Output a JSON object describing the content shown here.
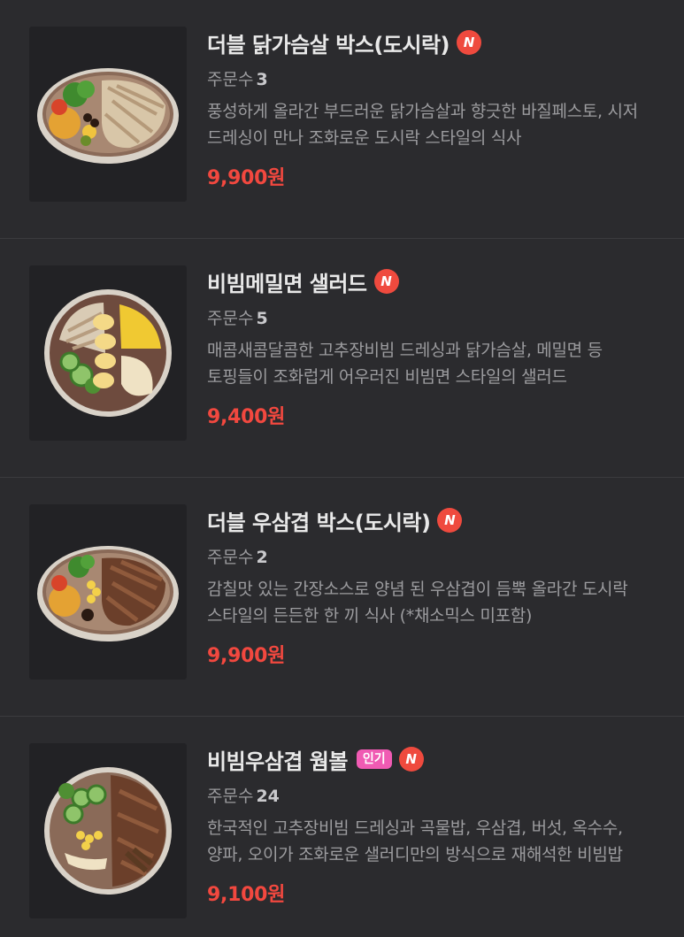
{
  "colors": {
    "background": "#2b2b2e",
    "price": "#f2483f",
    "new_badge": "#ef4a3e",
    "popular_badge": "#f05bb3",
    "divider": "#3b3b3e"
  },
  "labels": {
    "orders_prefix": "주문수",
    "new_badge": "N",
    "popular_badge": "인기"
  },
  "menu": [
    {
      "title": "더블 닭가슴살 박스(도시락)",
      "orders": "3",
      "description": "풍성하게 올라간 부드러운 닭가슴살과 향긋한 바질페스토, 시저 드레싱이 만나 조화로운 도시락 스타일의 식사",
      "price": "9,900원",
      "is_popular": false,
      "is_new": true,
      "image_icon": "chicken-breast-bowl-image"
    },
    {
      "title": "비빔메밀면 샐러드",
      "orders": "5",
      "description": "매콤새콤달콤한 고추장비빔 드레싱과 닭가슴살, 메밀면 등 토핑들이 조화럽게 어우러진 비빔면 스타일의 샐러드",
      "price": "9,400원",
      "is_popular": false,
      "is_new": true,
      "image_icon": "buckwheat-noodle-salad-image"
    },
    {
      "title": "더블 우삼겹 박스(도시락)",
      "orders": "2",
      "description": "감칠맛 있는 간장소스로 양념 된 우삼겹이 듬뿍 올라간 도시락 스타일의 든든한 한 끼 식사 (*채소믹스 미포함)",
      "price": "9,900원",
      "is_popular": false,
      "is_new": true,
      "image_icon": "beef-brisket-bowl-image"
    },
    {
      "title": "비빔우삼겹 웜볼",
      "orders": "24",
      "description": "한국적인 고추장비빔 드레싱과 곡물밥, 우삼겹, 버섯, 옥수수, 양파, 오이가 조화로운 샐러디만의 방식으로 재해석한 비빔밥",
      "price": "9,100원",
      "is_popular": true,
      "is_new": true,
      "image_icon": "bibim-beef-warm-bowl-image"
    }
  ]
}
